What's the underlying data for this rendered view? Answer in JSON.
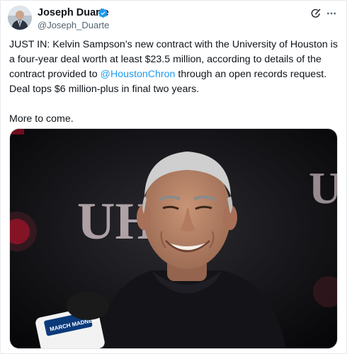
{
  "author": {
    "name": "Joseph Duarte",
    "handle": "@Joseph_Duarte",
    "verified": true,
    "avatar_icon": "profile-photo"
  },
  "header_actions": [
    {
      "icon": "grok-icon"
    },
    {
      "icon": "more-icon"
    }
  ],
  "tweet": {
    "text_part1": "JUST IN: Kelvin Sampson’s new contract with the University of Houston is a four-year deal worth at least $23.5 million, according to details of the contract provided to ",
    "mention": "@HoustonChron",
    "text_part2": " through an open records request.  Deal tops $6 million-plus in final two years.",
    "closing": "More to come."
  },
  "media": {
    "type": "photo",
    "logo_text": "UH",
    "microphone_label": "MARCH MADNESS"
  },
  "colors": {
    "link": "#1d9bf0",
    "verified": "#1d9bf0",
    "text": "#0f1419",
    "secondary": "#536471",
    "backdrop": "#0b0b0d",
    "logo_red": "#c8102e"
  }
}
